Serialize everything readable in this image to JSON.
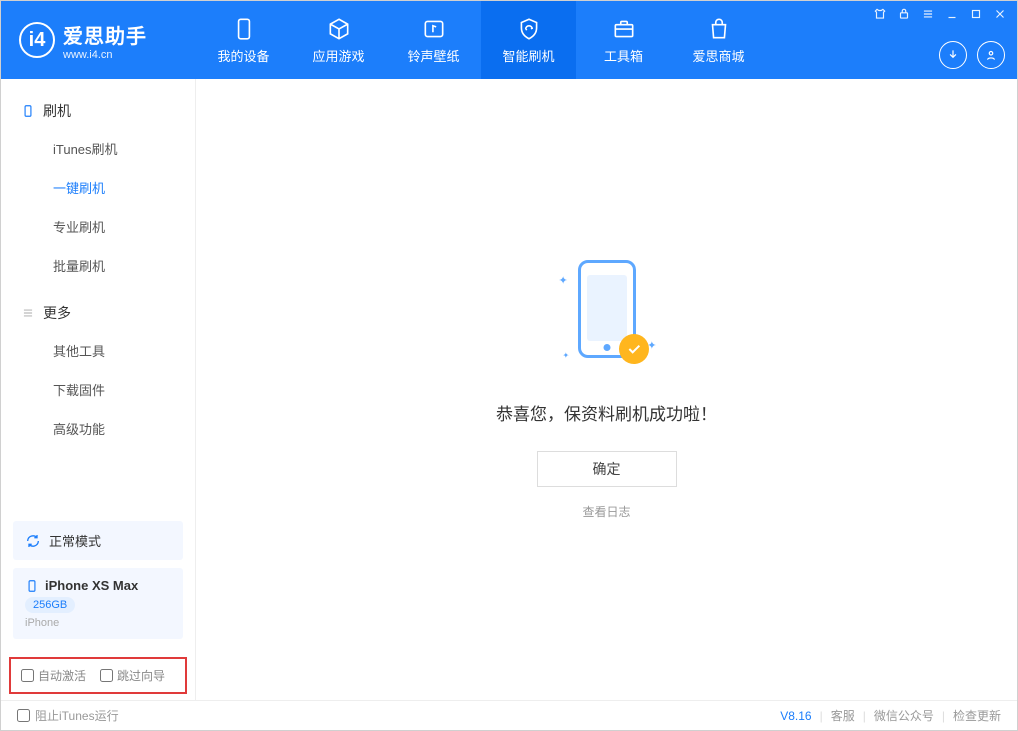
{
  "app": {
    "title": "爱思助手",
    "subtitle": "www.i4.cn"
  },
  "nav": {
    "device": "我的设备",
    "apps": "应用游戏",
    "ringtone": "铃声壁纸",
    "flash": "智能刷机",
    "toolbox": "工具箱",
    "store": "爱思商城"
  },
  "sidebar": {
    "group_flash": "刷机",
    "items_flash": {
      "itunes": "iTunes刷机",
      "onekey": "一键刷机",
      "pro": "专业刷机",
      "batch": "批量刷机"
    },
    "group_more": "更多",
    "items_more": {
      "other": "其他工具",
      "firmware": "下载固件",
      "advanced": "高级功能"
    },
    "status_mode": "正常模式",
    "device_name": "iPhone XS Max",
    "device_storage": "256GB",
    "device_type": "iPhone",
    "check_auto_activate": "自动激活",
    "check_skip_guide": "跳过向导"
  },
  "main": {
    "success": "恭喜您，保资料刷机成功啦！",
    "ok": "确定",
    "view_log": "查看日志"
  },
  "footer": {
    "block_itunes": "阻止iTunes运行",
    "version": "V8.16",
    "service": "客服",
    "wechat": "微信公众号",
    "update": "检查更新"
  }
}
